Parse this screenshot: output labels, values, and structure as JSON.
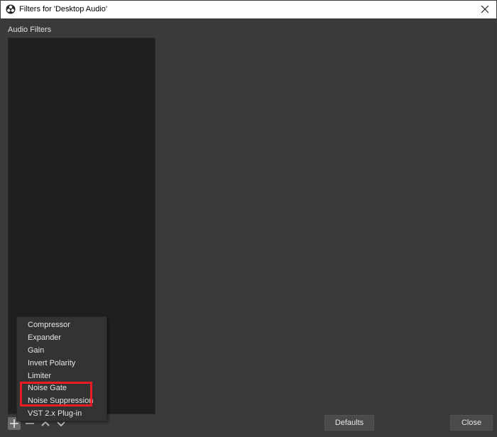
{
  "window": {
    "title": "Filters for 'Desktop Audio'",
    "app_icon": "obs-logo-icon",
    "close_icon": "close-icon"
  },
  "section": {
    "label": "Audio Filters"
  },
  "filter_list": {
    "items": []
  },
  "toolbar": {
    "add_icon": "plus-icon",
    "remove_icon": "minus-icon",
    "move_up_icon": "chevron-up-icon",
    "move_down_icon": "chevron-down-icon"
  },
  "context_menu": {
    "items": [
      {
        "label": "Compressor"
      },
      {
        "label": "Expander"
      },
      {
        "label": "Gain"
      },
      {
        "label": "Invert Polarity"
      },
      {
        "label": "Limiter"
      },
      {
        "label": "Noise Gate"
      },
      {
        "label": "Noise Suppression"
      },
      {
        "label": "VST 2.x Plug-in"
      }
    ],
    "highlighted": [
      "Noise Gate",
      "Noise Suppression"
    ],
    "highlight_color": "#e81c24"
  },
  "buttons": {
    "defaults_label": "Defaults",
    "close_label": "Close"
  }
}
